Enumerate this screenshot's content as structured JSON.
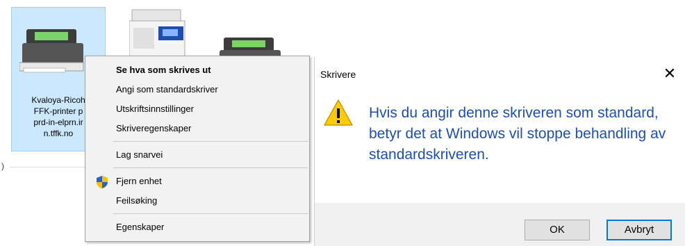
{
  "printer": {
    "label_lines": [
      "Kvaloya-Ricoh",
      "FFK-printer p",
      "prd-in-elprn.ir",
      "n.tffk.no"
    ]
  },
  "context_menu": {
    "items": [
      {
        "label": "Se hva som skrives ut",
        "bold": true
      },
      {
        "label": "Angi som standardskriver"
      },
      {
        "label": "Utskriftsinnstillinger"
      },
      {
        "label": "Skriveregenskaper"
      },
      {
        "label": "Lag snarvei"
      },
      {
        "label": "Fjern enhet",
        "icon": "shield-icon"
      },
      {
        "label": "Feilsøking"
      },
      {
        "label": "Egenskaper"
      }
    ]
  },
  "dialog": {
    "title": "Skrivere",
    "close_glyph": "✕",
    "icon": "warning-icon",
    "message": "Hvis du angir denne skriveren som standard, betyr det at Windows vil stoppe behandling av standardskriveren.",
    "ok_label": "OK",
    "cancel_label": "Avbryt"
  },
  "colors": {
    "selection": "#cce8ff",
    "message_text": "#1f4fa8",
    "default_button_border": "#0078d7"
  }
}
